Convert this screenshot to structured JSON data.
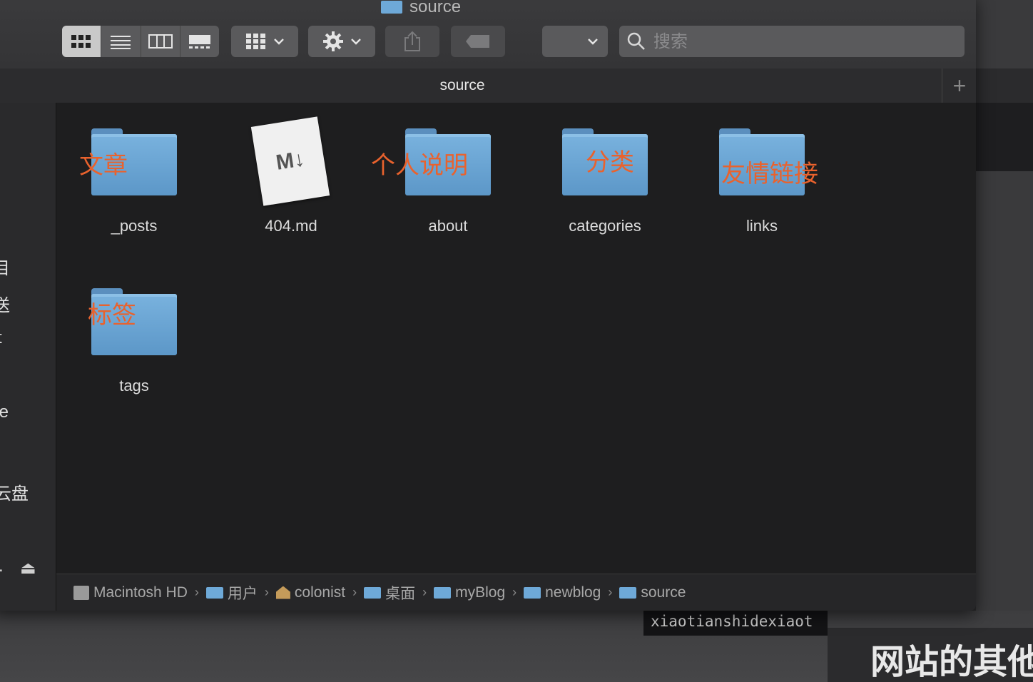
{
  "window": {
    "title": "source"
  },
  "toolbar": {
    "search_placeholder": "搜索"
  },
  "tab": {
    "title": "source",
    "add": "+"
  },
  "sidebar": {
    "fragments": [
      "目",
      "送",
      "t",
      "/e",
      "云盘",
      ".",
      "⏏"
    ]
  },
  "items": [
    {
      "name": "_posts",
      "kind": "folder",
      "annotation": "文章"
    },
    {
      "name": "404.md",
      "kind": "markdown-file",
      "icon_text": "M↓"
    },
    {
      "name": "about",
      "kind": "folder",
      "annotation": "个人说明"
    },
    {
      "name": "categories",
      "kind": "folder",
      "annotation": "分类"
    },
    {
      "name": "links",
      "kind": "folder",
      "annotation": "友情链接"
    },
    {
      "name": "tags",
      "kind": "folder",
      "annotation": "标签"
    }
  ],
  "pathbar": {
    "crumbs": [
      "Macintosh HD",
      "用户",
      "colonist",
      "桌面",
      "myBlog",
      "newblog",
      "source"
    ],
    "separator": "›"
  },
  "background": {
    "terminal_text": "xiaotianshidexiaot",
    "heading_fragment": "网站的其他"
  },
  "colors": {
    "annotation": "#e9622d",
    "folder": "#6ea9d8"
  }
}
